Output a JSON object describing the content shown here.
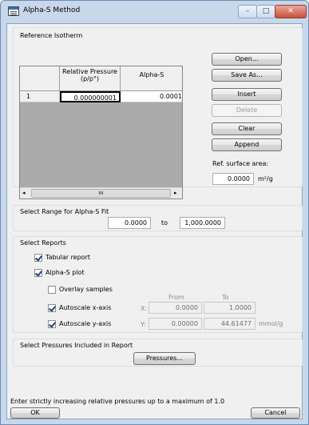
{
  "window": {
    "title": "Alpha-S Method",
    "controls": {
      "minimize": "–",
      "maximize": "□",
      "close": "✕"
    }
  },
  "reference_isotherm": {
    "title": "Reference Isotherm",
    "grid": {
      "columns": [
        "",
        "Relative Pressure (p/p°)",
        "Alpha-S"
      ],
      "rows": [
        {
          "index": "1",
          "pressure": "0.000000001",
          "alpha": "0.0001"
        }
      ],
      "scroll_grip": "ııı"
    },
    "buttons": {
      "open": "Open...",
      "save_as": "Save As...",
      "insert": "Insert",
      "delete": "Delete",
      "clear": "Clear",
      "append": "Append"
    },
    "ref_surface_area_label": "Ref. surface area:",
    "ref_surface_area_value": "0.0000",
    "ref_surface_area_unit": "m²/g"
  },
  "range": {
    "title": "Select Range for Alpha-S Fit",
    "from_value": "0.0000",
    "to_label": "to",
    "to_value": "1,000.0000"
  },
  "reports": {
    "title": "Select Reports",
    "tabular_report": {
      "label": "Tabular report",
      "checked": true
    },
    "alpha_s_plot": {
      "label": "Alpha-S plot",
      "checked": true
    },
    "overlay_samples": {
      "label": "Overlay samples",
      "checked": false
    },
    "from_header": "From",
    "to_header": "To",
    "autoscale_x": {
      "label": "Autoscale x-axis",
      "checked": true,
      "axis": "X:",
      "from": "0.0000",
      "to": "1.0000"
    },
    "autoscale_y": {
      "label": "Autoscale y-axis",
      "checked": true,
      "axis": "Y:",
      "from": "0.00000",
      "to": "44.61477",
      "unit": "mmol/g"
    }
  },
  "pressures": {
    "title": "Select Pressures Included in Report",
    "button": "Pressures..."
  },
  "status_text": "Enter strictly increasing relative pressures up to a maximum of 1.0",
  "footer": {
    "ok": "OK",
    "cancel": "Cancel"
  }
}
